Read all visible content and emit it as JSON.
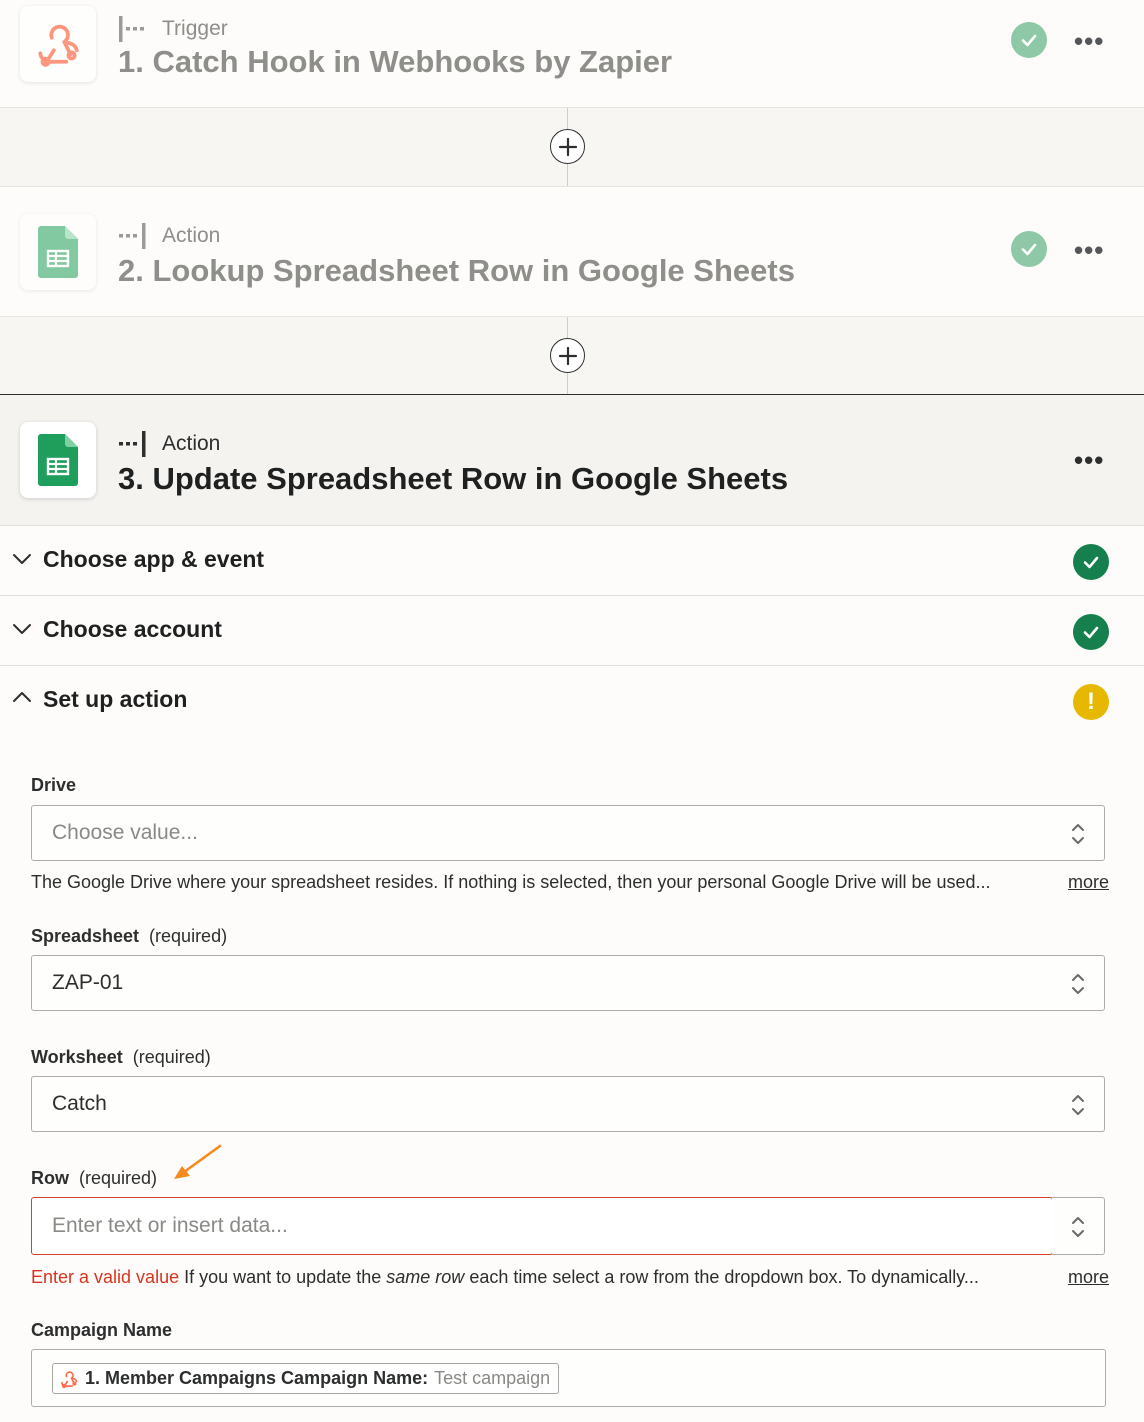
{
  "steps": [
    {
      "kind": "Trigger",
      "title": "1. Catch Hook in Webhooks by Zapier",
      "icon": "webhook-icon"
    },
    {
      "kind": "Action",
      "title": "2. Lookup Spreadsheet Row in Google Sheets",
      "icon": "google-sheets-icon"
    },
    {
      "kind": "Action",
      "title": "3. Update Spreadsheet Row in Google Sheets",
      "icon": "google-sheets-icon"
    }
  ],
  "sections": [
    {
      "label": "Choose app & event",
      "status": "complete"
    },
    {
      "label": "Choose account",
      "status": "complete"
    },
    {
      "label": "Set up action",
      "status": "warning"
    }
  ],
  "fields": {
    "drive": {
      "label": "Drive",
      "placeholder": "Choose value...",
      "help": "The Google Drive where your spreadsheet resides. If nothing is selected, then your personal Google Drive will be used...",
      "more": "more"
    },
    "spreadsheet": {
      "label": "Spreadsheet",
      "required": "(required)",
      "value": "ZAP-01"
    },
    "worksheet": {
      "label": "Worksheet",
      "required": "(required)",
      "value": "Catch"
    },
    "row": {
      "label": "Row",
      "required": "(required)",
      "placeholder": "Enter text or insert data...",
      "error": "Enter a valid value",
      "help_pre": "If you want to update the",
      "help_em": "same row",
      "help_post": "each time select a row from the dropdown box. To dynamically...",
      "more": "more"
    },
    "campaign_name": {
      "label": "Campaign Name",
      "pill_key": "1. Member Campaigns Campaign Name:",
      "pill_value": "Test campaign"
    }
  },
  "colors": {
    "webhook_orange": "#ff6b4a",
    "sheets_green": "#1e9e5a",
    "success_green": "#157f4e",
    "warning_yellow": "#e6b800",
    "error_red": "#d9341f",
    "annotation_arrow": "#f28a1e"
  }
}
